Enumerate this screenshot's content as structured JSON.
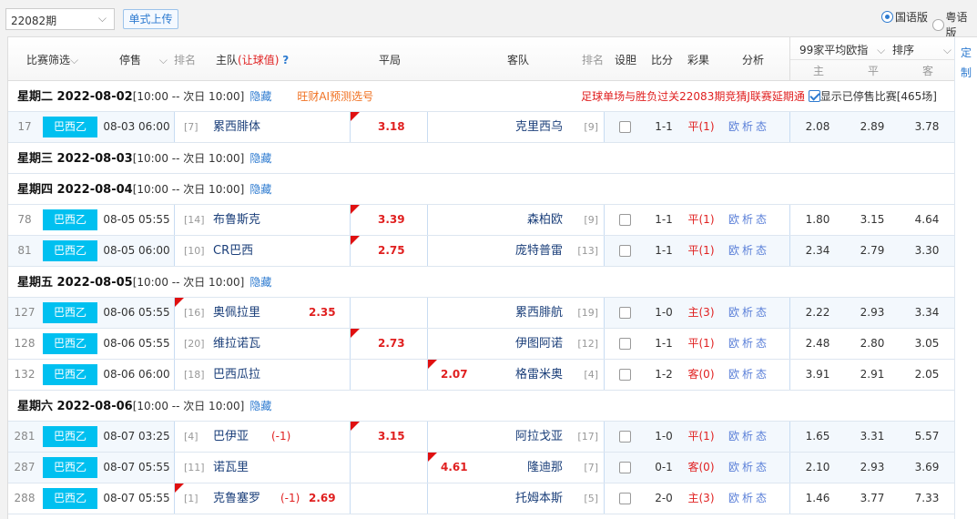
{
  "toolbar": {
    "period": "22082期",
    "upload": "单式上传",
    "radio_mandarin": "国语版",
    "radio_cantonese": "粤语版",
    "custom": "定制"
  },
  "header": {
    "filter": "比赛筛选",
    "stop": "停售",
    "rank": "排名",
    "home": "主队",
    "handicap": "(让球值)",
    "help": "?",
    "draw": "平局",
    "away": "客队",
    "rank2": "排名",
    "banker": "设胆",
    "score": "比分",
    "result": "彩果",
    "analysis": "分析",
    "odds_title": "99家平均欧指",
    "sort": "排序",
    "h": "主",
    "d": "平",
    "a": "客"
  },
  "colors": {
    "league_badge": "#00c0f0",
    "odds_red": "#e02020",
    "link_blue": "#2e7bd0"
  },
  "groups": [
    {
      "day": "星期二 2022-08-02",
      "range": "[10:00 -- 次日 10:00]",
      "hide": "隐藏",
      "ai": "旺财AI预测选号",
      "notice": "足球单场与胜负过关22083期竞猜J联赛延期通",
      "show_stopped": "显示已停售比赛",
      "count": "[465场]"
    },
    {
      "day": "星期三 2022-08-03",
      "range": "[10:00 -- 次日 10:00]",
      "hide": "隐藏"
    },
    {
      "day": "星期四 2022-08-04",
      "range": "[10:00 -- 次日 10:00]",
      "hide": "隐藏"
    },
    {
      "day": "星期五 2022-08-05",
      "range": "[10:00 -- 次日 10:00]",
      "hide": "隐藏"
    },
    {
      "day": "星期六 2022-08-06",
      "range": "[10:00 -- 次日 10:00]",
      "hide": "隐藏"
    }
  ],
  "matches": [
    {
      "num": "17",
      "league": "巴西乙",
      "time": "08-03 06:00",
      "home_rank": "[7]",
      "home": "累西腓体",
      "handicap": "",
      "odds": "3.18",
      "pick": "draw",
      "away": "克里西乌",
      "away_rank": "[9]",
      "score": "1-1",
      "result": "平(1)",
      "analysis": "欧析态",
      "h": "2.08",
      "d": "2.89",
      "a": "3.78",
      "alt": true
    },
    {
      "num": "78",
      "league": "巴西乙",
      "time": "08-05 05:55",
      "home_rank": "[14]",
      "home": "布鲁斯克",
      "handicap": "",
      "odds": "3.39",
      "pick": "draw",
      "away": "森柏欧",
      "away_rank": "[9]",
      "score": "1-1",
      "result": "平(1)",
      "analysis": "欧析态",
      "h": "1.80",
      "d": "3.15",
      "a": "4.64",
      "alt": false
    },
    {
      "num": "81",
      "league": "巴西乙",
      "time": "08-05 06:00",
      "home_rank": "[10]",
      "home": "CR巴西",
      "handicap": "",
      "odds": "2.75",
      "pick": "draw",
      "away": "庞特普雷",
      "away_rank": "[13]",
      "score": "1-1",
      "result": "平(1)",
      "analysis": "欧析态",
      "h": "2.34",
      "d": "2.79",
      "a": "3.30",
      "alt": true
    },
    {
      "num": "127",
      "league": "巴西乙",
      "time": "08-06 05:55",
      "home_rank": "[16]",
      "home": "奥佩拉里",
      "handicap": "",
      "odds": "2.35",
      "pick": "home",
      "away": "累西腓航",
      "away_rank": "[19]",
      "score": "1-0",
      "result": "主(3)",
      "analysis": "欧析态",
      "h": "2.22",
      "d": "2.93",
      "a": "3.34",
      "alt": true
    },
    {
      "num": "128",
      "league": "巴西乙",
      "time": "08-06 05:55",
      "home_rank": "[20]",
      "home": "维拉诺瓦",
      "handicap": "",
      "odds": "2.73",
      "pick": "draw",
      "away": "伊图阿诺",
      "away_rank": "[12]",
      "score": "1-1",
      "result": "平(1)",
      "analysis": "欧析态",
      "h": "2.48",
      "d": "2.80",
      "a": "3.05",
      "alt": false
    },
    {
      "num": "132",
      "league": "巴西乙",
      "time": "08-06 06:00",
      "home_rank": "[18]",
      "home": "巴西瓜拉",
      "handicap": "",
      "odds": "2.07",
      "pick": "away",
      "away": "格雷米奥",
      "away_rank": "[4]",
      "score": "1-2",
      "result": "客(0)",
      "analysis": "欧析态",
      "h": "3.91",
      "d": "2.91",
      "a": "2.05",
      "alt": false
    },
    {
      "num": "281",
      "league": "巴西乙",
      "time": "08-07 03:25",
      "home_rank": "[4]",
      "home": "巴伊亚",
      "handicap": "(-1)",
      "odds": "3.15",
      "pick": "draw",
      "away": "阿拉戈亚",
      "away_rank": "[17]",
      "score": "1-0",
      "result": "平(1)",
      "analysis": "欧析态",
      "h": "1.65",
      "d": "3.31",
      "a": "5.57",
      "alt": true
    },
    {
      "num": "287",
      "league": "巴西乙",
      "time": "08-07 05:55",
      "home_rank": "[11]",
      "home": "诺瓦里",
      "handicap": "",
      "odds": "4.61",
      "pick": "away",
      "away": "隆迪那",
      "away_rank": "[7]",
      "score": "0-1",
      "result": "客(0)",
      "analysis": "欧析态",
      "h": "2.10",
      "d": "2.93",
      "a": "3.69",
      "alt": true
    },
    {
      "num": "288",
      "league": "巴西乙",
      "time": "08-07 05:55",
      "home_rank": "[1]",
      "home": "克鲁塞罗",
      "handicap": "(-1)",
      "odds": "2.69",
      "pick": "home",
      "away": "托姆本斯",
      "away_rank": "[5]",
      "score": "2-0",
      "result": "主(3)",
      "analysis": "欧析态",
      "h": "1.46",
      "d": "3.77",
      "a": "7.33",
      "alt": false
    }
  ]
}
